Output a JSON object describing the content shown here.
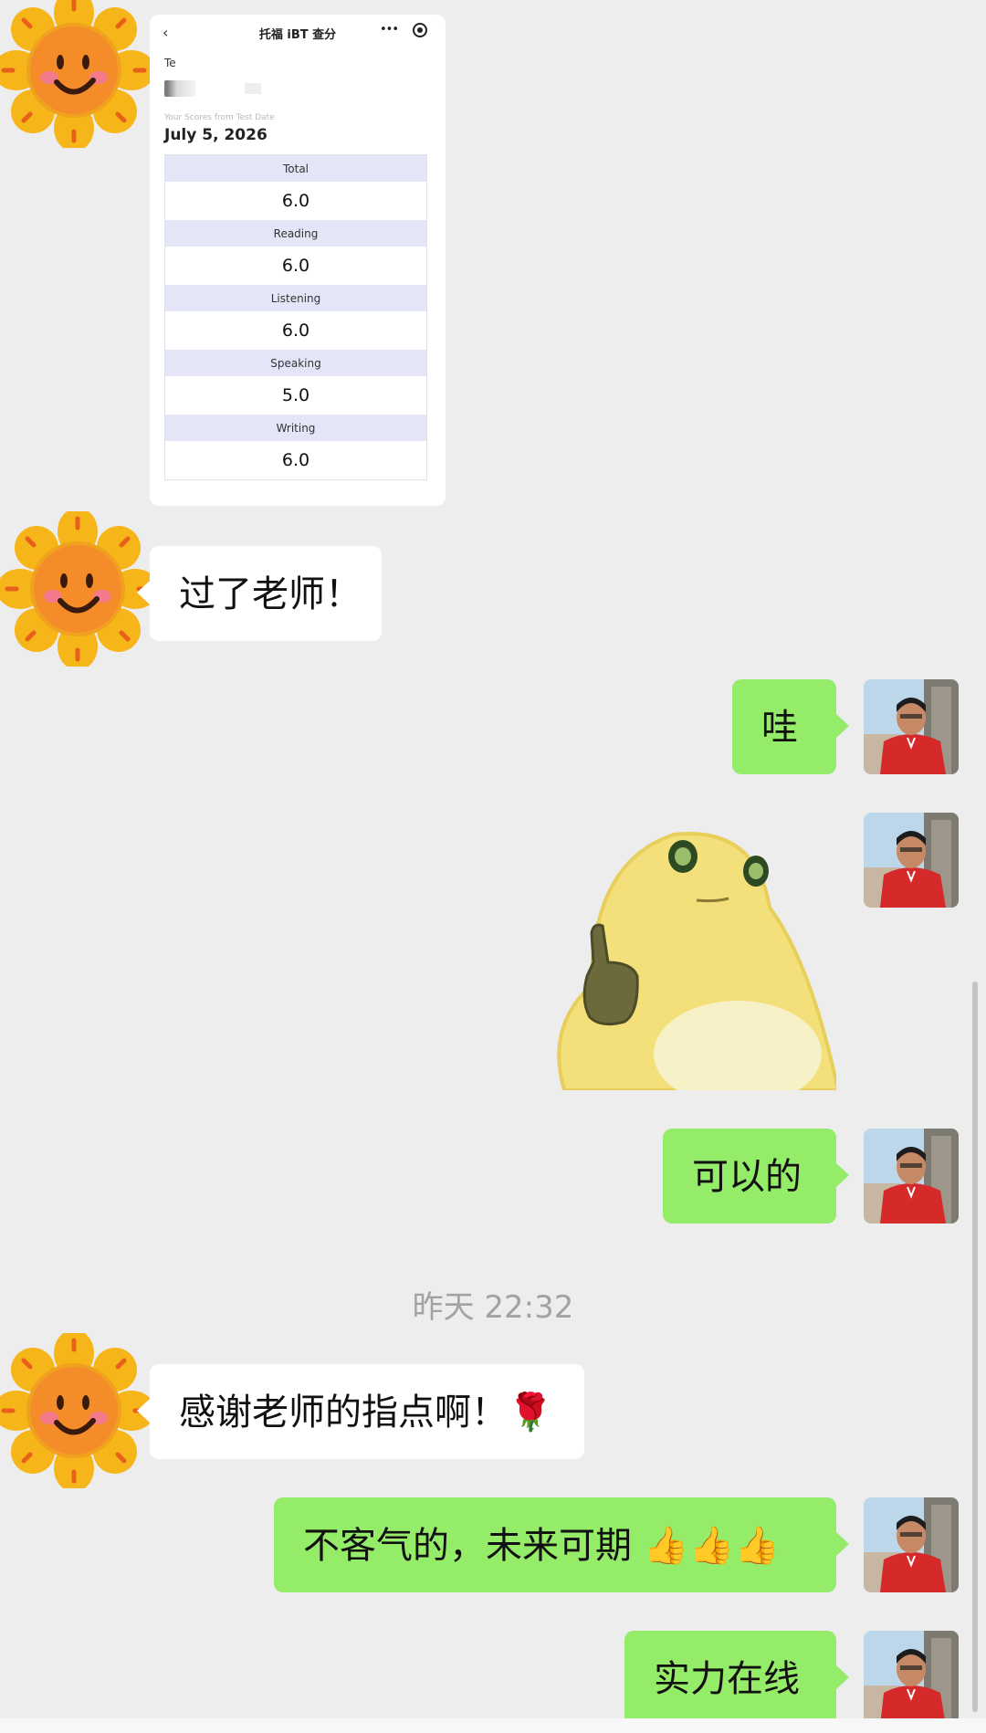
{
  "card": {
    "title": "托福 iBT 查分",
    "back_icon": "chevron-left-icon",
    "more_icon": "more-dots-icon",
    "close_icon": "target-icon",
    "te_text": "Te",
    "scores_from": "Your Scores from Test Date",
    "date": "July 5, 2026",
    "scores": [
      {
        "label": "Total",
        "value": "6.0"
      },
      {
        "label": "Reading",
        "value": "6.0"
      },
      {
        "label": "Listening",
        "value": "6.0"
      },
      {
        "label": "Speaking",
        "value": "5.0"
      },
      {
        "label": "Writing",
        "value": "6.0"
      }
    ]
  },
  "messages": {
    "m1": "过了老师！",
    "m2": "哇",
    "m3": "可以的",
    "timestamp": "昨天 22:32",
    "m4": "感谢老师的指点啊！🌹",
    "m5": "不客气的，未来可期 👍👍👍",
    "m6": "实力在线"
  },
  "colors": {
    "background": "#ededed",
    "right_bubble": "#95ec69",
    "left_bubble": "#ffffff"
  },
  "icons": {
    "friend_avatar": "sunflower-avatar",
    "my_avatar": "person-photo-avatar",
    "sticker": "thumbs-up-creature-sticker"
  }
}
